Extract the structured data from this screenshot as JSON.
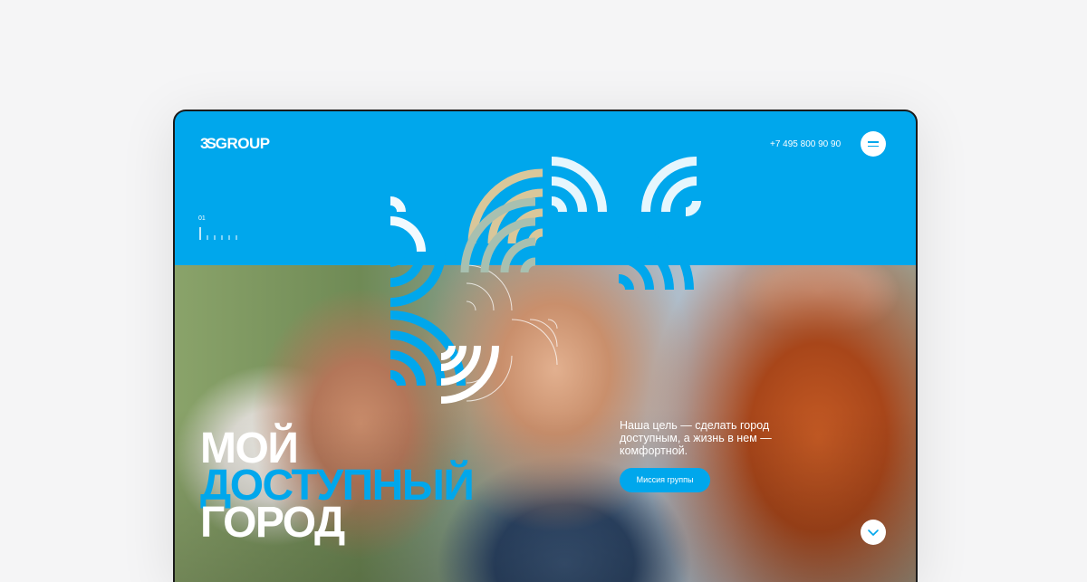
{
  "header": {
    "logo_mark": "3S",
    "logo_text": "GROUP",
    "phone": "+7 495 800 90 90",
    "menu_icon": "hamburger-icon"
  },
  "slider": {
    "number": "01",
    "scroll_icon": "chevron-down-icon"
  },
  "hero": {
    "line1": "МОЙ",
    "line2": "ДОСТУПНЫЙ",
    "line3": "ГОРОД",
    "tagline": "Наша цель — сделать город доступным, а жизнь в нем — комфортной.",
    "button_label": "Миссия группы"
  },
  "colors": {
    "brand_blue": "#00a7ec",
    "white": "#ffffff",
    "page_bg": "#f5f5f6"
  }
}
